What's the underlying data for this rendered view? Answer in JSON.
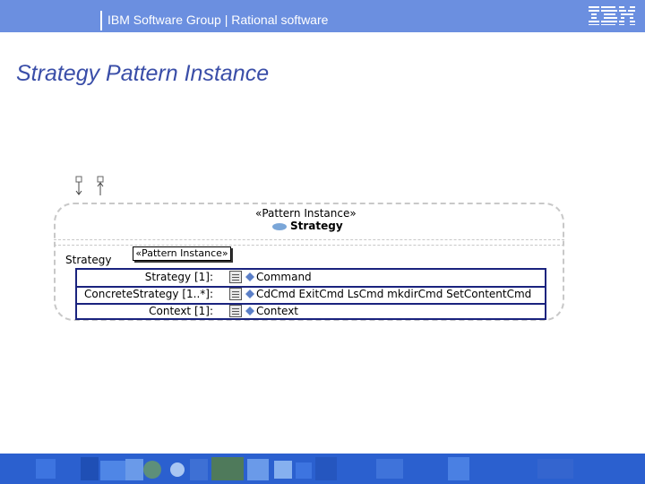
{
  "header": {
    "text": "IBM Software Group | Rational software",
    "logo": "IBM"
  },
  "page": {
    "title": "Strategy Pattern Instance"
  },
  "diagram": {
    "stereotype": "«Pattern Instance»",
    "class_name": "Strategy",
    "part_name": "Strategy",
    "part_stereotype": "«Pattern Instance»",
    "parameters": [
      {
        "label": "Strategy [1]:",
        "value": "Command"
      },
      {
        "label": "ConcreteStrategy [1..*]:",
        "value": "CdCmd ExitCmd LsCmd mkdirCmd SetContentCmd"
      },
      {
        "label": "Context [1]:",
        "value": "Context"
      }
    ]
  },
  "colors": {
    "header_bg": "#6b8fe0",
    "title_color": "#3a4ea8",
    "footer_bg": "#2b60cf",
    "table_border": "#1a237e"
  }
}
